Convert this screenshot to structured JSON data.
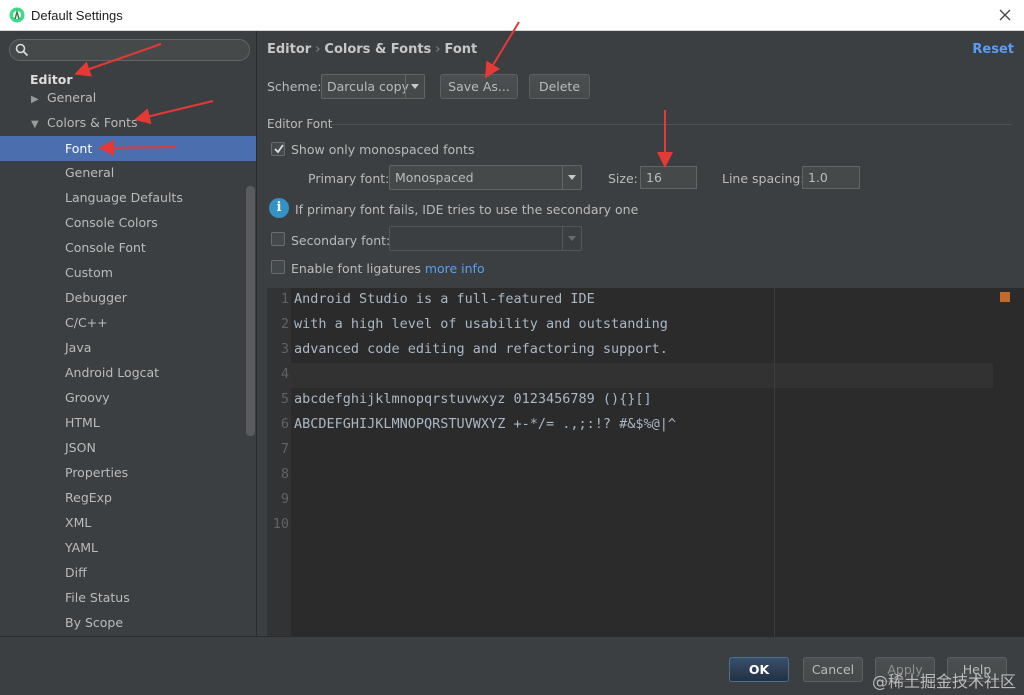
{
  "window": {
    "title": "Default Settings"
  },
  "sidebar": {
    "search_placeholder": "",
    "items": [
      {
        "label": "Editor"
      },
      {
        "label": "General"
      },
      {
        "label": "Colors & Fonts"
      },
      {
        "label": "Font"
      },
      {
        "label": "General"
      },
      {
        "label": "Language Defaults"
      },
      {
        "label": "Console Colors"
      },
      {
        "label": "Console Font"
      },
      {
        "label": "Custom"
      },
      {
        "label": "Debugger"
      },
      {
        "label": "C/C++"
      },
      {
        "label": "Java"
      },
      {
        "label": "Android Logcat"
      },
      {
        "label": "Groovy"
      },
      {
        "label": "HTML"
      },
      {
        "label": "JSON"
      },
      {
        "label": "Properties"
      },
      {
        "label": "RegExp"
      },
      {
        "label": "XML"
      },
      {
        "label": "YAML"
      },
      {
        "label": "Diff"
      },
      {
        "label": "File Status"
      },
      {
        "label": "By Scope"
      }
    ]
  },
  "breadcrumb": {
    "part1": "Editor",
    "part2": "Colors & Fonts",
    "part3": "Font",
    "sep": "›"
  },
  "reset": "Reset",
  "scheme": {
    "label": "Scheme:",
    "value": "Darcula copy",
    "save_as": "Save As...",
    "delete": "Delete"
  },
  "editor_font": {
    "section": "Editor Font",
    "monospaced_label": "Show only monospaced fonts",
    "primary_label": "Primary font:",
    "primary_value": "Monospaced",
    "size_label": "Size:",
    "size_value": "16",
    "line_spacing_label": "Line spacing:",
    "line_spacing_value": "1.0",
    "info_text": "If primary font fails, IDE tries to use the secondary one",
    "secondary_label": "Secondary font:",
    "secondary_value": "",
    "ligatures_label": "Enable font ligatures",
    "more_info": "more info"
  },
  "preview": {
    "lines": [
      {
        "n": "1",
        "text": "Android Studio is a full-featured IDE"
      },
      {
        "n": "2",
        "text": "with a high level of usability and outstanding"
      },
      {
        "n": "3",
        "text": "advanced code editing and refactoring support."
      },
      {
        "n": "4",
        "text": ""
      },
      {
        "n": "5",
        "text": "abcdefghijklmnopqrstuvwxyz 0123456789 (){}[]"
      },
      {
        "n": "6",
        "text": "ABCDEFGHIJKLMNOPQRSTUVWXYZ +-*/= .,;:!? #&$%@|^"
      },
      {
        "n": "7",
        "text": ""
      },
      {
        "n": "8",
        "text": ""
      },
      {
        "n": "9",
        "text": ""
      },
      {
        "n": "10",
        "text": ""
      }
    ]
  },
  "footer": {
    "ok": "OK",
    "cancel": "Cancel",
    "apply": "Apply",
    "help": "Help"
  },
  "watermark": "@稀土掘金技术社区",
  "colors": {
    "selection": "#4b6eaf",
    "link": "#589df6",
    "annotation_arrow": "#e53935"
  }
}
